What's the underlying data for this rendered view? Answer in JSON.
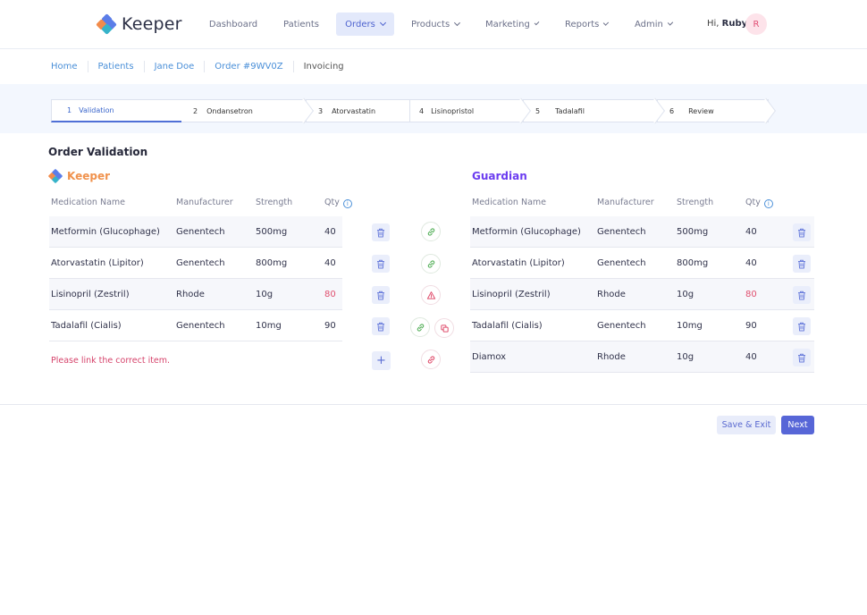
{
  "app": {
    "brand": "Keeper"
  },
  "nav": {
    "items": [
      {
        "label": "Dashboard",
        "dropdown": false,
        "active": false
      },
      {
        "label": "Patients",
        "dropdown": false,
        "active": false
      },
      {
        "label": "Orders",
        "dropdown": true,
        "active": true
      },
      {
        "label": "Products",
        "dropdown": true,
        "active": false
      },
      {
        "label": "Marketing",
        "dropdown": true,
        "active": false
      },
      {
        "label": "Reports",
        "dropdown": true,
        "active": false
      },
      {
        "label": "Admin",
        "dropdown": true,
        "active": false
      }
    ],
    "greeting": "Hi,",
    "user": "Ruby",
    "avatar_initial": "R"
  },
  "breadcrumb": [
    "Home",
    "Patients",
    "Jane Doe",
    "Order #9WV0Z",
    "Invoicing"
  ],
  "steps": [
    {
      "num": "1",
      "label": "Validation",
      "active": true
    },
    {
      "num": "2",
      "label": "Ondansetron",
      "active": false
    },
    {
      "num": "3",
      "label": "Atorvastatin",
      "active": false
    },
    {
      "num": "4",
      "label": "Lisinopristol",
      "active": false
    },
    {
      "num": "5",
      "label": "Tadalafil",
      "active": false
    },
    {
      "num": "6",
      "label": "Review",
      "active": false
    }
  ],
  "page_title": "Order Validation",
  "headers": {
    "medication": "Medication Name",
    "manufacturer": "Manufacturer",
    "strength": "Strength",
    "qty": "Qty",
    "info": "i"
  },
  "keeper": {
    "label": "Keeper",
    "rows": [
      {
        "name": "Metformin (Glucophage)",
        "manufacturer": "Genentech",
        "strength": "500mg",
        "qty": "40",
        "qty_alert": false
      },
      {
        "name": "Atorvastatin (Lipitor)",
        "manufacturer": "Genentech",
        "strength": "800mg",
        "qty": "40",
        "qty_alert": false
      },
      {
        "name": "Lisinopril (Zestril)",
        "manufacturer": "Rhode",
        "strength": "10g",
        "qty": "80",
        "qty_alert": true
      },
      {
        "name": "Tadalafil (Cialis)",
        "manufacturer": "Genentech",
        "strength": "10mg",
        "qty": "90",
        "qty_alert": false
      }
    ],
    "message": "Please link the correct item.",
    "add_label": "+"
  },
  "guardian": {
    "label": "Guardian",
    "rows": [
      {
        "name": "Metformin (Glucophage)",
        "manufacturer": "Genentech",
        "strength": "500mg",
        "qty": "40",
        "qty_alert": false
      },
      {
        "name": "Atorvastatin (Lipitor)",
        "manufacturer": "Genentech",
        "strength": "800mg",
        "qty": "40",
        "qty_alert": false
      },
      {
        "name": "Lisinopril (Zestril)",
        "manufacturer": "Rhode",
        "strength": "10g",
        "qty": "80",
        "qty_alert": true
      },
      {
        "name": "Tadalafil (Cialis)",
        "manufacturer": "Genentech",
        "strength": "10mg",
        "qty": "90",
        "qty_alert": false
      },
      {
        "name": "Diamox",
        "manufacturer": "Rhode",
        "strength": "10g",
        "qty": "40",
        "qty_alert": false
      }
    ]
  },
  "link_status": [
    "link-icon",
    "link-icon",
    "warning-icon",
    "link-icon+duplicate-icon",
    "broken-link-icon"
  ],
  "colors": {
    "accent": "#5766d7",
    "brand_keeper": "#f0924d",
    "brand_guardian": "#6b3cf0",
    "alert": "#e0506f",
    "link_ok": "#4caf50"
  },
  "actions": {
    "save": "Save & Exit",
    "next": "Next"
  }
}
